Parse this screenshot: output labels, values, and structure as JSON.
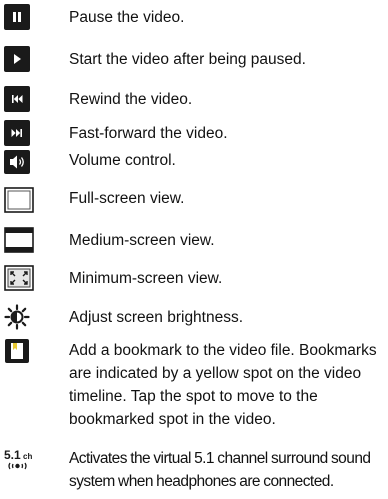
{
  "items": [
    {
      "icon": "pause-icon",
      "text": "Pause the video."
    },
    {
      "icon": "play-icon",
      "text": "Start the video after being paused."
    },
    {
      "icon": "rewind-icon",
      "text": "Rewind the video."
    },
    {
      "icon": "fast-forward-icon",
      "text": "Fast-forward the video."
    },
    {
      "icon": "volume-icon",
      "text": "Volume control."
    },
    {
      "icon": "full-screen-icon",
      "text": "Full-screen view."
    },
    {
      "icon": "medium-screen-icon",
      "text": "Medium-screen view."
    },
    {
      "icon": "minimum-screen-icon",
      "text": "Minimum-screen view."
    },
    {
      "icon": "brightness-icon",
      "text": "Adjust screen brightness."
    },
    {
      "icon": "bookmark-icon",
      "text": "Add a bookmark to the video file. Bookmarks are indicated by a yellow spot on the video timeline. Tap the spot to move to the bookmarked spot in the video."
    },
    {
      "icon": "surround-sound-icon",
      "text": "Activates the virtual 5.1 channel surround sound system when headphones are connected."
    }
  ],
  "surround_icon_text": {
    "main": "5.1",
    "sub": "ch"
  },
  "colors": {
    "icon_dark": "#1a1a1a",
    "bookmark_accent": "#e8c832"
  }
}
